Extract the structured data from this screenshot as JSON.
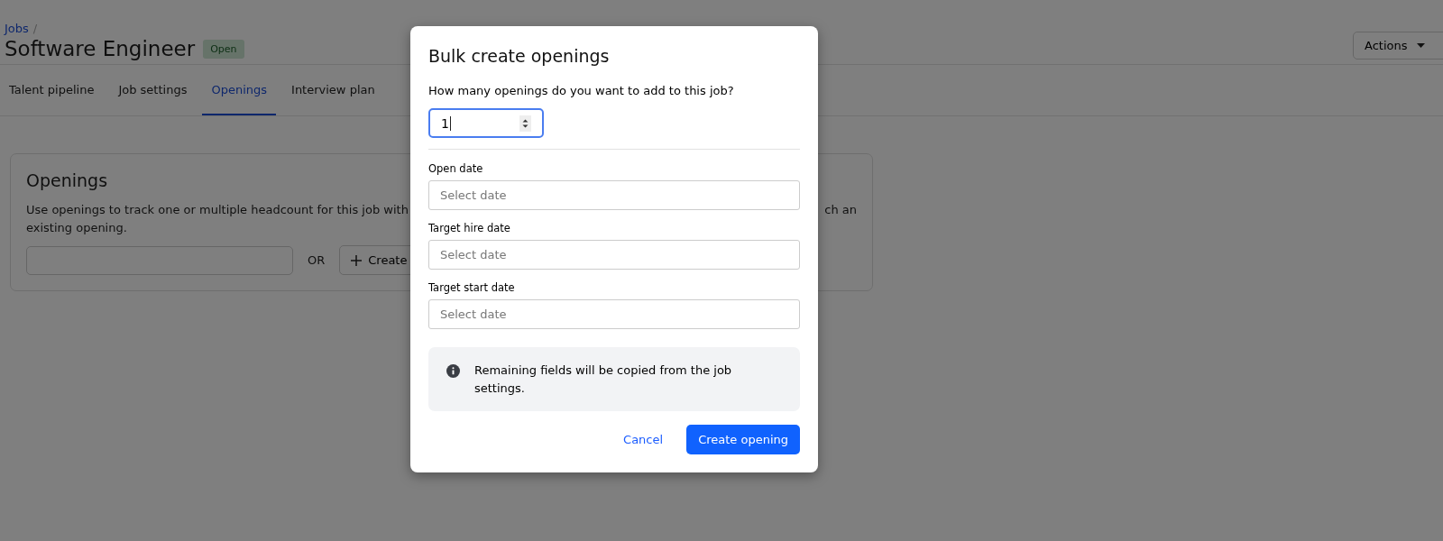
{
  "breadcrumb": {
    "link": "Jobs",
    "separator": "/"
  },
  "header": {
    "title": "Software Engineer",
    "status": "Open",
    "actions_button": "Actions"
  },
  "tabs": [
    {
      "label": "Talent pipeline",
      "selected": false
    },
    {
      "label": "Job settings",
      "selected": false
    },
    {
      "label": "Openings",
      "selected": true
    },
    {
      "label": "Interview plan",
      "selected": false
    }
  ],
  "openings_card": {
    "title": "Openings",
    "description_line_1_left": "Use openings to track one or multiple headcount for this job with",
    "description_line_1_right": "ch an",
    "description_line_2": "existing opening.",
    "or_label": "OR",
    "create_button": "Create"
  },
  "modal": {
    "title": "Bulk create openings",
    "question": "How many openings do you want to add to this job?",
    "count_value": "1",
    "date_fields": [
      {
        "label": "Open date",
        "placeholder": "Select date"
      },
      {
        "label": "Target hire date",
        "placeholder": "Select date"
      },
      {
        "label": "Target start date",
        "placeholder": "Select date"
      }
    ],
    "info": "Remaining fields will be copied from the job settings.",
    "buttons": [
      {
        "kind": "link",
        "label": "Cancel"
      },
      {
        "kind": "primary",
        "label": "Create opening"
      }
    ]
  }
}
